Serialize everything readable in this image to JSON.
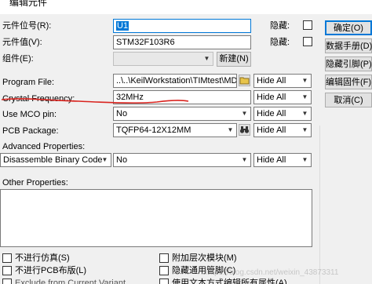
{
  "window": {
    "title": "编辑元件"
  },
  "fields": {
    "ref": {
      "label": "元件位号(R):",
      "value": "U1",
      "hidden_label": "隐藏:"
    },
    "value": {
      "label": "元件值(V):",
      "value": "STM32F103R6",
      "hidden_label": "隐藏:"
    },
    "group": {
      "label": "组件(E):",
      "value": "",
      "new_button": "新建(N)"
    },
    "program_file": {
      "label": "Program File:",
      "value": "..\\..\\KeilWorkstation\\TIMtest\\MDK-",
      "visibility": "Hide All"
    },
    "crystal": {
      "label": "Crystal Frequency:",
      "value": "32MHz",
      "visibility": "Hide All"
    },
    "mco": {
      "label": "Use MCO pin:",
      "value": "No",
      "visibility": "Hide All"
    },
    "pcb": {
      "label": "PCB Package:",
      "value": "TQFP64-12X12MM",
      "visibility": "Hide All"
    },
    "advanced": {
      "label": "Advanced Properties:",
      "property": "Disassemble Binary Code",
      "value": "No",
      "visibility": "Hide All"
    },
    "other": {
      "label": "Other Properties:",
      "value": ""
    }
  },
  "right_buttons": [
    {
      "label": "确定(O)"
    },
    {
      "label": "数据手册(D)"
    },
    {
      "label": "隐藏引脚(P)"
    },
    {
      "label": "编辑固件(F)"
    },
    {
      "label": "取消(C)"
    }
  ],
  "checkboxes": {
    "no_sim": {
      "label": "不进行仿真(S)",
      "checked": false
    },
    "no_pcb": {
      "label": "不进行PCB布版(L)",
      "checked": false
    },
    "exclude_variant": {
      "label": "Exclude from Current Variant",
      "checked": false
    },
    "attach_hierarchy": {
      "label": "附加层次模块(M)",
      "checked": false
    },
    "hide_common_pins": {
      "label": "隐藏通用管脚(C)",
      "checked": false
    },
    "edit_all_props": {
      "label": "使用文本方式编辑所有属性(A)",
      "checked": false
    }
  },
  "watermark": "https://blog.csdn.net/weixin_43873311"
}
